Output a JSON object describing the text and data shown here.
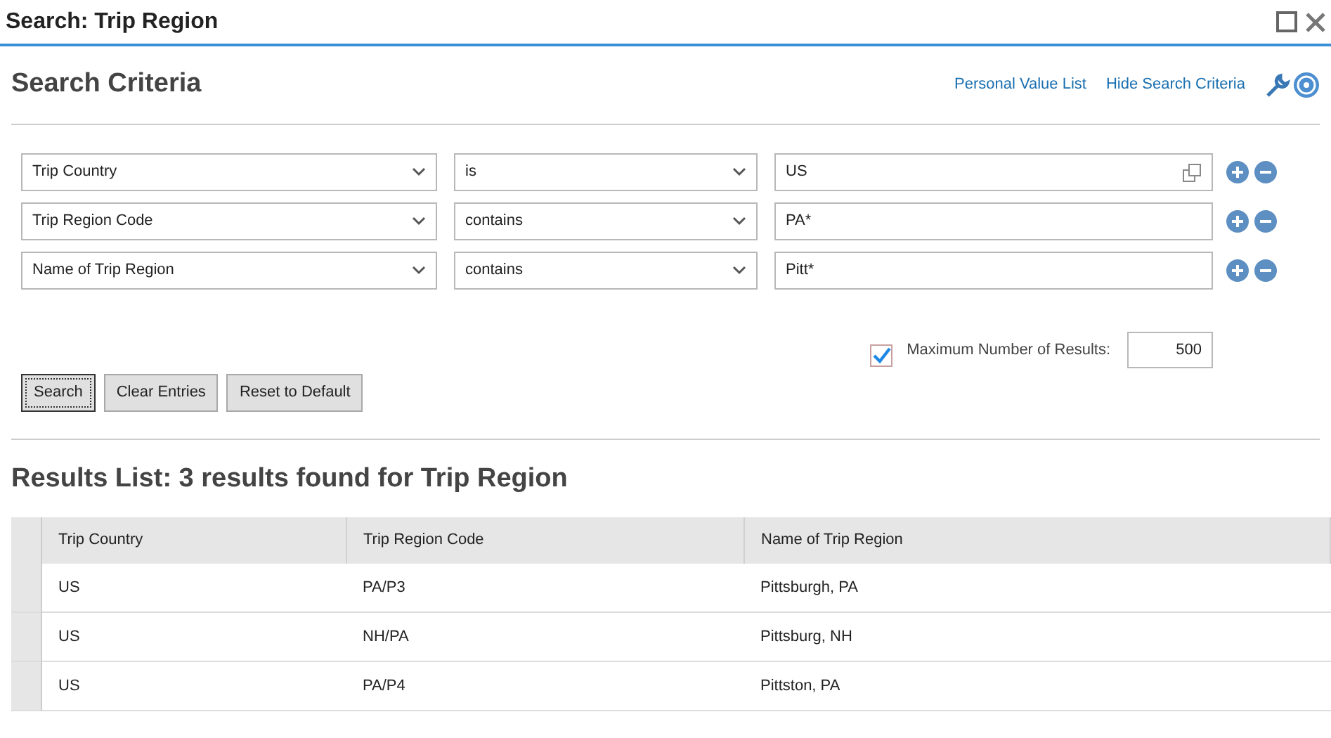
{
  "window": {
    "title": "Search: Trip Region"
  },
  "criteria": {
    "title": "Search Criteria",
    "links": [
      "Personal Value List",
      "Hide Search Criteria"
    ],
    "rows": [
      {
        "field": "Trip Country",
        "operator": "is",
        "value": "US",
        "value_help": true
      },
      {
        "field": "Trip Region Code",
        "operator": "contains",
        "value": "PA*",
        "value_help": false
      },
      {
        "field": "Name of Trip Region",
        "operator": "contains",
        "value": "Pitt*",
        "value_help": false
      }
    ],
    "max_results": {
      "checked": true,
      "label": "Maximum Number of Results:",
      "value": "500"
    },
    "buttons": [
      {
        "label": "Search",
        "selected": true
      },
      {
        "label": "Clear Entries",
        "selected": false
      },
      {
        "label": "Reset to Default",
        "selected": false
      }
    ]
  },
  "results": {
    "title": "Results List: 3 results found for Trip Region",
    "columns": [
      "Trip Country",
      "Trip Region Code",
      "Name of Trip Region"
    ],
    "rows": [
      [
        "US",
        "PA/P3",
        "Pittsburgh, PA"
      ],
      [
        "US",
        "NH/PA",
        "Pittsburg, NH"
      ],
      [
        "US",
        "PA/P4",
        "Pittston, PA"
      ]
    ]
  }
}
